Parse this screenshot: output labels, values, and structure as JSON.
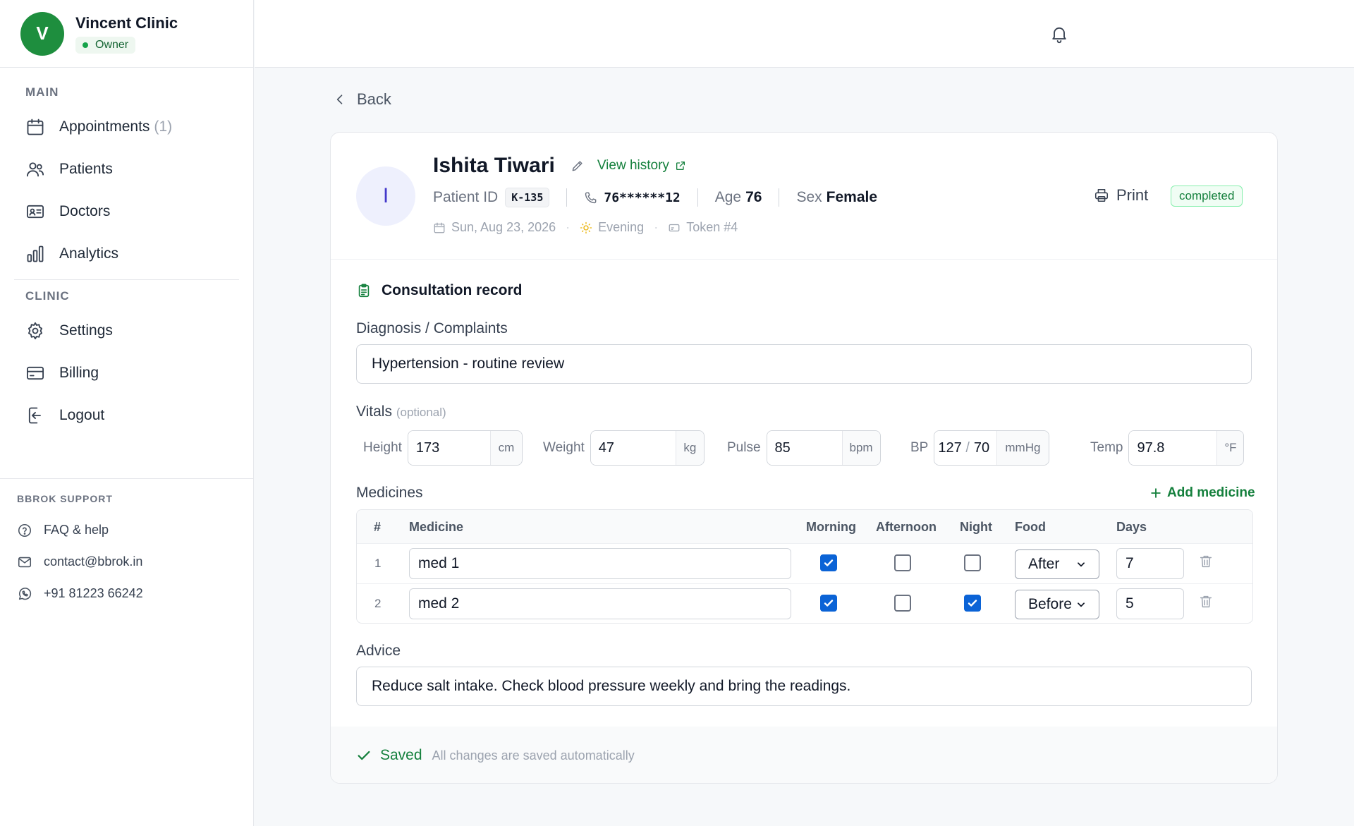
{
  "brand": {
    "initial": "V",
    "name": "Vincent Clinic",
    "role": "Owner"
  },
  "sidebar": {
    "main_heading": "MAIN",
    "main_items": [
      {
        "label": "Appointments",
        "count": "(1)",
        "icon": "calendar-icon"
      },
      {
        "label": "Patients",
        "icon": "users-icon"
      },
      {
        "label": "Doctors",
        "icon": "id-card-icon"
      },
      {
        "label": "Analytics",
        "icon": "bar-chart-icon"
      }
    ],
    "clinic_heading": "CLINIC",
    "clinic_items": [
      {
        "label": "Settings",
        "icon": "gear-icon"
      },
      {
        "label": "Billing",
        "icon": "credit-card-icon"
      },
      {
        "label": "Logout",
        "icon": "logout-icon"
      }
    ],
    "support_heading": "BBROK SUPPORT",
    "support_items": [
      {
        "label": "FAQ & help",
        "icon": "help-circle-icon"
      },
      {
        "label": "contact@bbrok.in",
        "icon": "mail-icon"
      },
      {
        "label": "+91 81223 66242",
        "icon": "whatsapp-icon"
      }
    ]
  },
  "topbar": {
    "notifications_icon": "bell-icon"
  },
  "back": {
    "label": "Back"
  },
  "patient": {
    "initial": "I",
    "name": "Ishita Tiwari",
    "view_history": "View history",
    "id_label": "Patient ID",
    "id_value": "K-135",
    "phone": "76******12",
    "age_label": "Age",
    "age_value": "76",
    "sex_label": "Sex",
    "sex_value": "Female",
    "date": "Sun, Aug 23, 2026",
    "session": "Evening",
    "token": "Token #4",
    "print_label": "Print",
    "status": "completed"
  },
  "consultation": {
    "title": "Consultation record",
    "diagnosis_label": "Diagnosis / Complaints",
    "diagnosis_value": "Hypertension - routine review",
    "vitals_label": "Vitals",
    "vitals_optional": "(optional)",
    "vitals": {
      "height": {
        "label": "Height",
        "value": "173",
        "unit": "cm"
      },
      "weight": {
        "label": "Weight",
        "value": "47",
        "unit": "kg"
      },
      "pulse": {
        "label": "Pulse",
        "value": "85",
        "unit": "bpm"
      },
      "bp": {
        "label": "BP",
        "systolic": "127",
        "separator": "/",
        "diastolic": "70",
        "unit": "mmHg"
      },
      "temp": {
        "label": "Temp",
        "value": "97.8",
        "unit": "°F"
      }
    },
    "medicines_label": "Medicines",
    "add_medicine": "Add medicine",
    "medicine_columns": {
      "num": "#",
      "medicine": "Medicine",
      "morning": "Morning",
      "afternoon": "Afternoon",
      "night": "Night",
      "food": "Food",
      "days": "Days"
    },
    "medicines": [
      {
        "num": "1",
        "name": "med 1",
        "morning": true,
        "afternoon": false,
        "night": false,
        "food": "After",
        "days": "7"
      },
      {
        "num": "2",
        "name": "med 2",
        "morning": true,
        "afternoon": false,
        "night": true,
        "food": "Before",
        "days": "5"
      }
    ],
    "advice_label": "Advice",
    "advice_value": "Reduce salt intake. Check blood pressure weekly and bring the readings."
  },
  "footer": {
    "saved": "Saved",
    "note": "All changes are saved automatically"
  },
  "colors": {
    "brand": "#1e8e3e",
    "accent_green": "#15803d",
    "checkbox_blue": "#0b63d6",
    "avatar_bg": "#eef0fd"
  }
}
